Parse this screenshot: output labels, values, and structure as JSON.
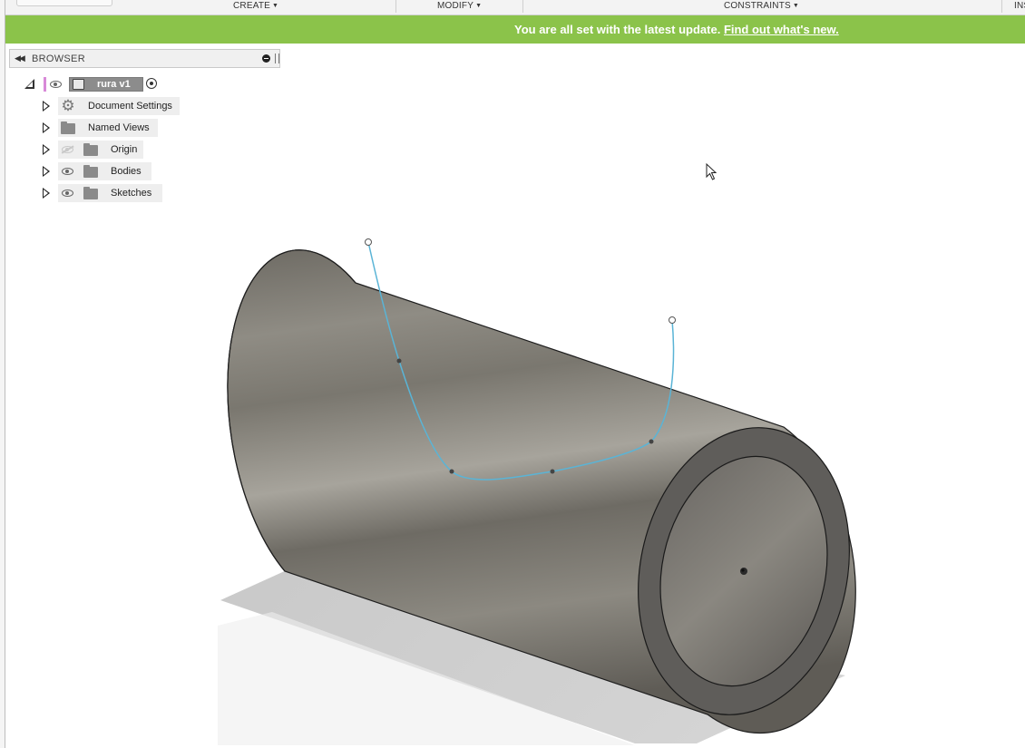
{
  "toolbar": {
    "menus": [
      {
        "label": "CREATE"
      },
      {
        "label": "MODIFY"
      },
      {
        "label": "CONSTRAINTS"
      },
      {
        "label": "INS"
      }
    ]
  },
  "banner": {
    "message": "You are all set with the latest update.",
    "link": "Find out what's new.",
    "color": "#8bc34a"
  },
  "browser": {
    "title": "BROWSER",
    "root": {
      "label": "rura v1",
      "visible": true,
      "active": true
    },
    "items": [
      {
        "label": "Document Settings",
        "icon": "gear-icon"
      },
      {
        "label": "Named Views",
        "icon": "folder-icon"
      },
      {
        "label": "Origin",
        "icon": "folder-icon",
        "visible": false
      },
      {
        "label": "Bodies",
        "icon": "folder-icon",
        "visible": true
      },
      {
        "label": "Sketches",
        "icon": "folder-icon",
        "visible": true
      }
    ]
  },
  "model": {
    "body_color": "#7b7870",
    "sketch_color": "#5ab4d6"
  }
}
